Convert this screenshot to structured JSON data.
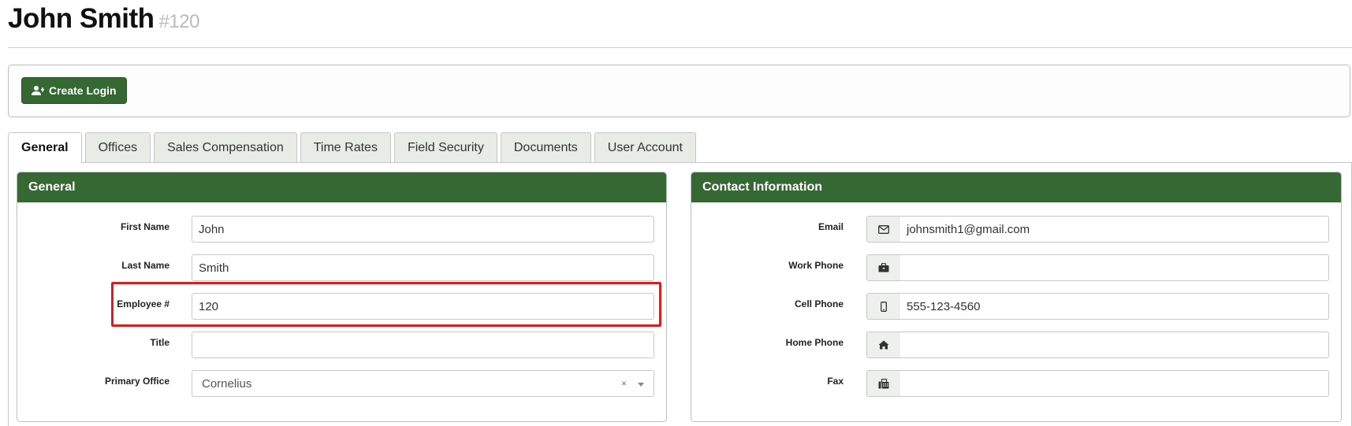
{
  "header": {
    "name": "John Smith",
    "id": "#120"
  },
  "actions": {
    "create_login": "Create Login"
  },
  "tabs": [
    {
      "label": "General",
      "active": true
    },
    {
      "label": "Offices"
    },
    {
      "label": "Sales Compensation"
    },
    {
      "label": "Time Rates"
    },
    {
      "label": "Field Security"
    },
    {
      "label": "Documents"
    },
    {
      "label": "User Account"
    }
  ],
  "general": {
    "title": "General",
    "first_name": {
      "label": "First Name",
      "value": "John"
    },
    "last_name": {
      "label": "Last Name",
      "value": "Smith"
    },
    "employee_num": {
      "label": "Employee #",
      "value": "120"
    },
    "title_field": {
      "label": "Title",
      "value": ""
    },
    "primary_office": {
      "label": "Primary Office",
      "value": "Cornelius",
      "clear": "×"
    }
  },
  "contact": {
    "title": "Contact Information",
    "email": {
      "label": "Email",
      "value": "johnsmith1@gmail.com",
      "icon": "envelope-icon"
    },
    "work_phone": {
      "label": "Work Phone",
      "value": "",
      "icon": "briefcase-icon"
    },
    "cell_phone": {
      "label": "Cell Phone",
      "value": "555-123-4560",
      "icon": "mobile-phone-icon"
    },
    "home_phone": {
      "label": "Home Phone",
      "value": "",
      "icon": "home-icon"
    },
    "fax": {
      "label": "Fax",
      "value": "",
      "icon": "fax-icon"
    }
  },
  "colors": {
    "brand_green": "#356832",
    "highlight_red": "#d6201f"
  }
}
